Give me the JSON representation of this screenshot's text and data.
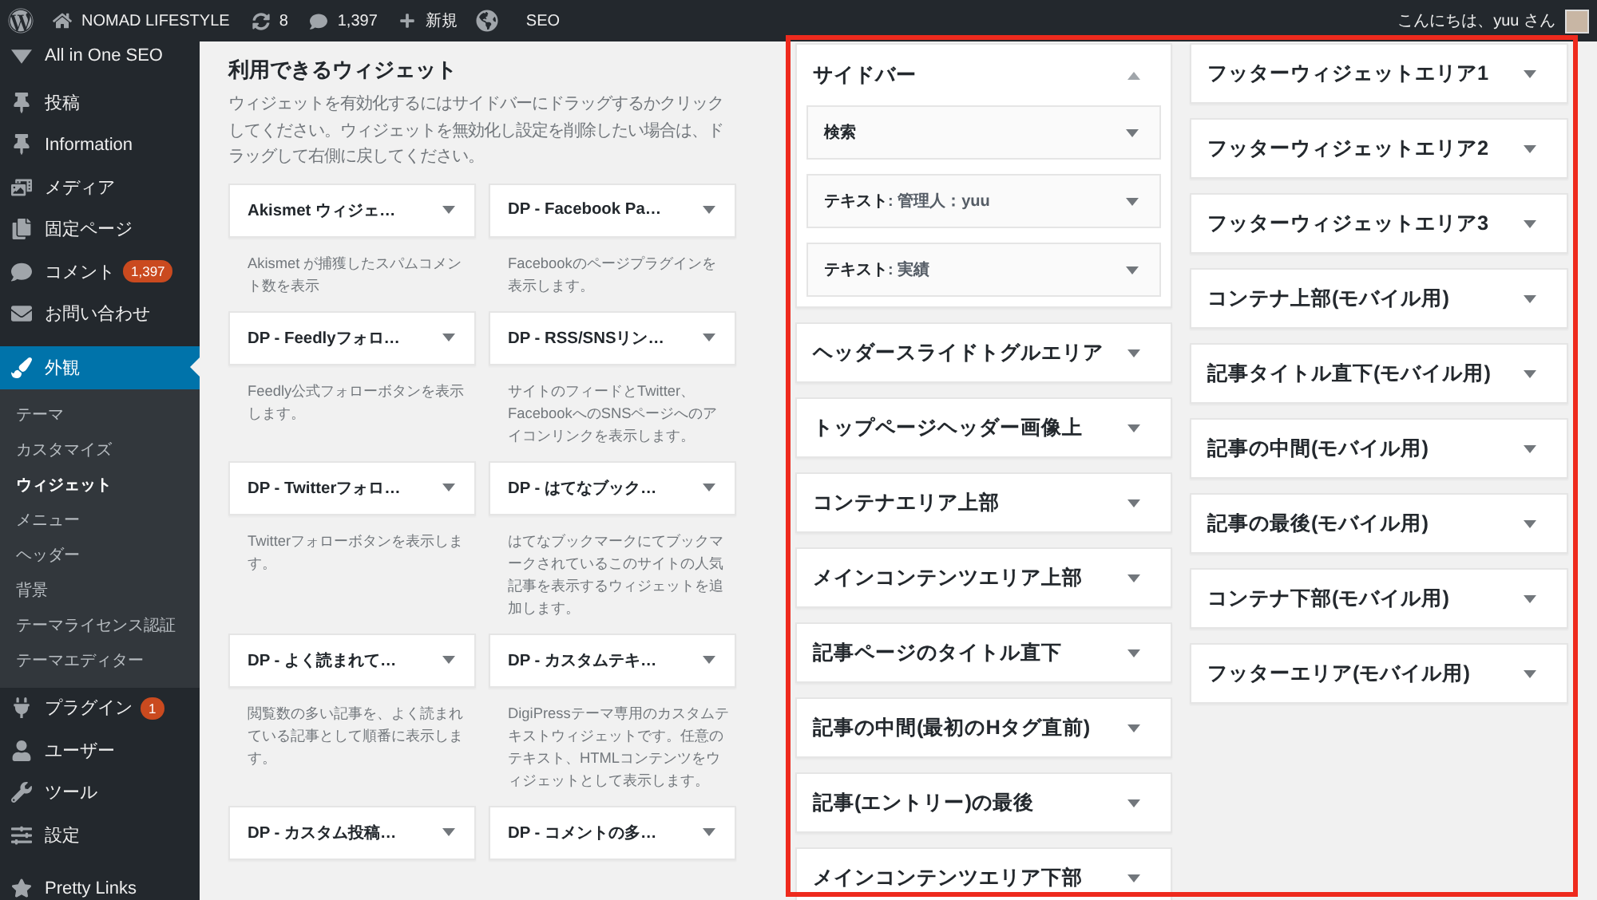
{
  "admin_bar": {
    "site_name": "NOMAD LIFESTYLE",
    "updates": "8",
    "comments": "1,397",
    "new_label": "新規",
    "seo_label": "SEO",
    "greeting": "こんにちは、yuu さん"
  },
  "menu_groups": [
    {
      "items": [
        {
          "label": "All in One SEO",
          "selected": false
        }
      ]
    },
    {
      "items": [
        {
          "label": "投稿",
          "selected": false
        },
        {
          "label": "Information",
          "selected": false
        },
        {
          "label": "メディア",
          "selected": false
        },
        {
          "label": "固定ページ",
          "selected": false
        },
        {
          "label": "コメント",
          "selected": false,
          "badge": "1,397"
        },
        {
          "label": "お問い合わせ",
          "selected": false
        }
      ]
    },
    {
      "items": [
        {
          "label": "外観",
          "selected": true,
          "children": [
            {
              "label": "テーマ",
              "selected": false
            },
            {
              "label": "カスタマイズ",
              "selected": false
            },
            {
              "label": "ウィジェット",
              "selected": true
            },
            {
              "label": "メニュー",
              "selected": false
            },
            {
              "label": "ヘッダー",
              "selected": false
            },
            {
              "label": "背景",
              "selected": false
            },
            {
              "label": "テーマライセンス認証",
              "selected": false
            },
            {
              "label": "テーマエディター",
              "selected": false
            }
          ]
        },
        {
          "label": "プラグイン",
          "selected": false,
          "badge": "1"
        },
        {
          "label": "ユーザー",
          "selected": false
        },
        {
          "label": "ツール",
          "selected": false
        },
        {
          "label": "設定",
          "selected": false
        }
      ]
    },
    {
      "items": [
        {
          "label": "Pretty Links",
          "selected": false
        }
      ]
    }
  ],
  "available_widgets": {
    "title": "利用できるウィジェット",
    "description": "ウィジェットを有効化するにはサイドバーにドラッグするかクリックしてください。ウィジェットを無効化し設定を削除したい場合は、ドラッグして右側に戻してください。",
    "widgets": [
      {
        "title": "Akismet ウィジェ…",
        "description": "Akismet が捕獲したスパムコメント数を表示"
      },
      {
        "title": "DP - Facebook Pa…",
        "description": "Facebookのページプラグインを表示します。"
      },
      {
        "title": "DP - Feedlyフォロ…",
        "description": "Feedly公式フォローボタンを表示します。"
      },
      {
        "title": "DP - RSS/SNSリン…",
        "description": "サイトのフィードとTwitter、FacebookへのSNSページへのアイコンリンクを表示します。"
      },
      {
        "title": "DP - Twitterフォロ…",
        "description": "Twitterフォローボタンを表示します。"
      },
      {
        "title": "DP - はてなブック…",
        "description": "はてなブックマークにてブックマークされているこのサイトの人気記事を表示するウィジェットを追加します。"
      },
      {
        "title": "DP - よく読まれて…",
        "description": "閲覧数の多い記事を、よく読まれている記事として順番に表示します。"
      },
      {
        "title": "DP - カスタムテキ…",
        "description": "DigiPressテーマ専用のカスタムテキストウィジェットです。任意のテキスト、HTMLコンテンツをウィジェットとして表示します。"
      },
      {
        "title": "DP - カスタム投稿…"
      },
      {
        "title": "DP - コメントの多…"
      }
    ]
  },
  "widget_areas": [
    {
      "areas": [
        {
          "title": "サイドバー",
          "expanded": true,
          "widgets": [
            {
              "name": "検索"
            },
            {
              "name": "テキスト",
              "instance": ": 管理人：yuu"
            },
            {
              "name": "テキスト",
              "instance": ": 実績"
            }
          ]
        },
        {
          "title": "ヘッダースライドトグルエリア",
          "expanded": false
        },
        {
          "title": "トップページヘッダー画像上",
          "expanded": false
        },
        {
          "title": "コンテナエリア上部",
          "expanded": false
        },
        {
          "title": "メインコンテンツエリア上部",
          "expanded": false
        },
        {
          "title": "記事ページのタイトル直下",
          "expanded": false
        },
        {
          "title": "記事の中間(最初のHタグ直前)",
          "expanded": false
        },
        {
          "title": "記事(エントリー)の最後",
          "expanded": false
        },
        {
          "title": "メインコンテンツエリア下部",
          "expanded": false
        }
      ]
    },
    {
      "areas": [
        {
          "title": "フッターウィジェットエリア1",
          "expanded": false
        },
        {
          "title": "フッターウィジェットエリア2",
          "expanded": false
        },
        {
          "title": "フッターウィジェットエリア3",
          "expanded": false
        },
        {
          "title": "コンテナ上部(モバイル用)",
          "expanded": false
        },
        {
          "title": "記事タイトル直下(モバイル用)",
          "expanded": false
        },
        {
          "title": "記事の中間(モバイル用)",
          "expanded": false
        },
        {
          "title": "記事の最後(モバイル用)",
          "expanded": false
        },
        {
          "title": "コンテナ下部(モバイル用)",
          "expanded": false
        },
        {
          "title": "フッターエリア(モバイル用)",
          "expanded": false
        }
      ]
    }
  ]
}
